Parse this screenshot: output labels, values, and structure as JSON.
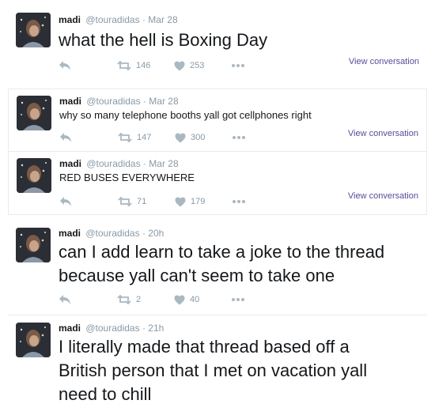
{
  "tweets": [
    {
      "name": "madi",
      "handle": "@touradidas",
      "dot": "·",
      "time": "Mar 28",
      "text": "what the hell is Boxing Day",
      "retweets": "146",
      "likes": "253",
      "view_conversation": "View conversation"
    },
    {
      "name": "madi",
      "handle": "@touradidas",
      "dot": "·",
      "time": "Mar 28",
      "text": "why so many telephone booths yall got cellphones right",
      "retweets": "147",
      "likes": "300",
      "view_conversation": "View conversation"
    },
    {
      "name": "madi",
      "handle": "@touradidas",
      "dot": "·",
      "time": "Mar 28",
      "text": "RED BUSES EVERYWHERE",
      "retweets": "71",
      "likes": "179",
      "view_conversation": "View conversation"
    },
    {
      "name": "madi",
      "handle": "@touradidas",
      "dot": "·",
      "time": "20h",
      "text": "can I add learn to take a joke to the thread because yall can't seem to take one",
      "retweets": "2",
      "likes": "40"
    },
    {
      "name": "madi",
      "handle": "@touradidas",
      "dot": "·",
      "time": "21h",
      "text": "I literally made that thread based off a British person that I met on vacation yall need to chill"
    }
  ],
  "icons": {
    "reply": "reply-icon",
    "retweet": "retweet-icon",
    "like": "heart-icon",
    "more": "more-icon"
  },
  "colors": {
    "text": "#14171a",
    "muted": "#8899a6",
    "icon": "#aab8c2",
    "link": "#5b4a9a",
    "border": "#e6ecf0"
  }
}
